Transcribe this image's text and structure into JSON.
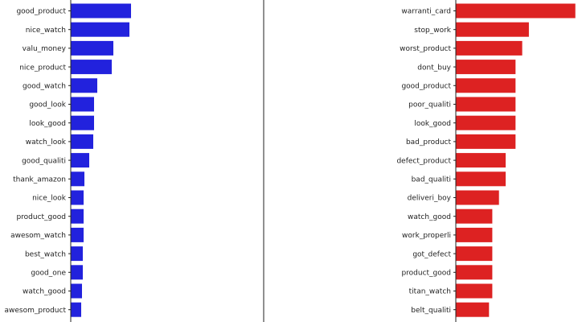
{
  "chart_data": [
    {
      "type": "bar",
      "orientation": "horizontal",
      "color": "#2222dd",
      "categories": [
        "good_product",
        "nice_watch",
        "valu_money",
        "nice_product",
        "good_watch",
        "good_look",
        "look_good",
        "watch_look",
        "good_qualiti",
        "thank_amazon",
        "nice_look",
        "product_good",
        "awesom_watch",
        "best_watch",
        "good_one",
        "watch_good",
        "awesom_product"
      ],
      "values": [
        75,
        73,
        53,
        51,
        33,
        29,
        29,
        28,
        23,
        17,
        16,
        16,
        16,
        15,
        15,
        14,
        13
      ],
      "xlim": [
        0,
        240
      ]
    },
    {
      "type": "bar",
      "orientation": "horizontal",
      "color": "#dd2222",
      "categories": [
        "warranti_card",
        "stop_work",
        "worst_product",
        "dont_buy",
        "good_product",
        "poor_qualiti",
        "look_good",
        "bad_product",
        "defect_product",
        "bad_qualiti",
        "deliveri_boy",
        "watch_good",
        "work_properli",
        "got_defect",
        "product_good",
        "titan_watch",
        "belt_qualiti"
      ],
      "values": [
        36,
        22,
        20,
        18,
        18,
        18,
        18,
        18,
        15,
        15,
        13,
        11,
        11,
        11,
        11,
        11,
        10
      ],
      "xlim": [
        0,
        36.8
      ]
    }
  ]
}
